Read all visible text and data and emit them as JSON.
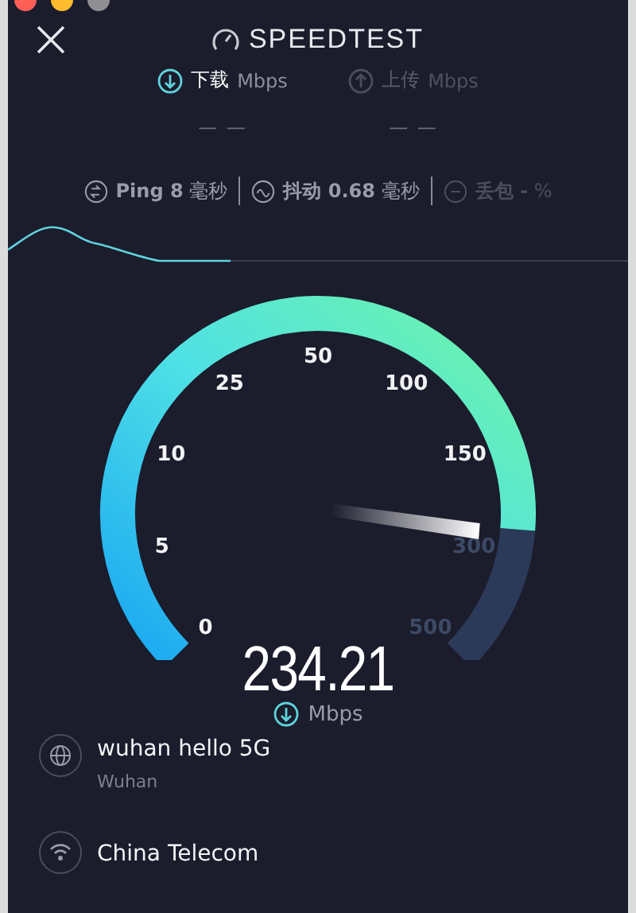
{
  "window": {
    "traffic_lights": [
      {
        "color": "#fe5f57"
      },
      {
        "color": "#febc2e"
      },
      {
        "color": "#8e8e93"
      }
    ]
  },
  "logo": {
    "text": "SPEEDTEST"
  },
  "tabs": [
    {
      "kind": "download",
      "label": "下载",
      "unit": "Mbps",
      "value": "— —",
      "selected": true
    },
    {
      "kind": "upload",
      "label": "上传",
      "unit": "Mbps",
      "value": "— —",
      "selected": false
    }
  ],
  "stats": [
    {
      "kind": "ping",
      "label": "Ping",
      "value": "8",
      "unit": "毫秒",
      "disabled": false
    },
    {
      "kind": "jitter",
      "label": "抖动",
      "value": "0.68",
      "unit": "毫秒",
      "disabled": false
    },
    {
      "kind": "loss",
      "label": "丢包",
      "value": "-",
      "unit": "%",
      "disabled": true
    }
  ],
  "gauge": {
    "ticks": [
      "0",
      "5",
      "10",
      "25",
      "50",
      "100",
      "150",
      "300",
      "500"
    ],
    "reading": "234.21",
    "unit": "Mbps"
  },
  "servers": [
    {
      "kind": "server",
      "name": "wuhan hello 5G",
      "location": "Wuhan"
    },
    {
      "kind": "provider",
      "name": "China Telecom"
    }
  ]
}
